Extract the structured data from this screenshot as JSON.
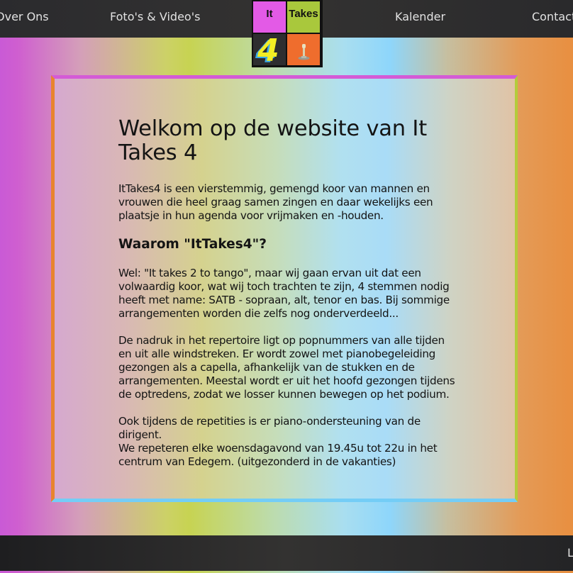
{
  "nav": {
    "items": [
      {
        "label": "Over Ons"
      },
      {
        "label": "Foto's & Video's"
      },
      {
        "label": "Kalender"
      },
      {
        "label": "Contact"
      }
    ],
    "logo": {
      "word1": "It",
      "word2": "Takes",
      "digit": "4"
    }
  },
  "main": {
    "title": "Welkom op de website van It Takes 4",
    "intro": "ItTakes4 is een vierstemmig, gemengd koor van mannen en vrouwen die heel graag samen zingen en daar wekelijks een plaatsje in hun agenda voor vrijmaken en -houden.",
    "subtitle": "Waarom \"ItTakes4\"?",
    "para1": "Wel: \"It takes 2 to tango\", maar wij gaan ervan uit dat een volwaardig koor, wat wij toch trachten te zijn, 4 stemmen nodig heeft met name: SATB - sopraan, alt, tenor en bas. Bij sommige arrangementen worden die zelfs nog onderverdeeld...",
    "para2": "De nadruk in het repertoire ligt op popnummers van alle tijden en uit alle windstreken. Er wordt zowel met pianobegeleiding gezongen als a capella, afhankelijk van de stukken en de arrangementen. Meestal wordt er uit het hoofd gezongen tijdens de optredens, zodat we losser kunnen bewegen op het podium.",
    "para3_line1": "Ook tijdens de repetities is er piano-ondersteuning van de dirigent.",
    "para3_line2": "We repeteren elke woensdagavond van 19.45u tot 22u in het centrum van Edegem. (uitgezonderd in de vakanties)"
  },
  "footer": {
    "link_partial": "L"
  }
}
